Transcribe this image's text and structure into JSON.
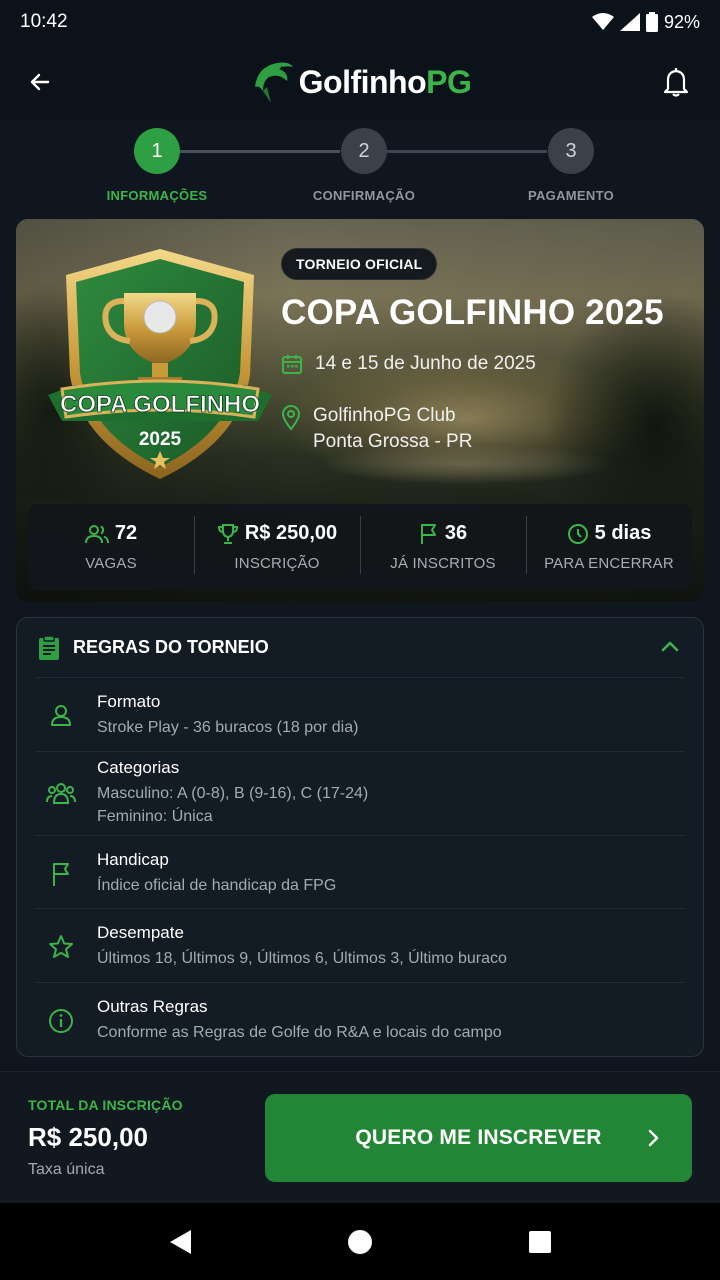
{
  "status": {
    "time": "10:42",
    "battery": "92%"
  },
  "header": {
    "logo_part1": "Golfinho",
    "logo_part2": "PG"
  },
  "steps": [
    {
      "number": "1",
      "label": "INFORMAÇÕES",
      "active": true
    },
    {
      "number": "2",
      "label": "CONFIRMAÇÃO",
      "active": false
    },
    {
      "number": "3",
      "label": "PAGAMENTO",
      "active": false
    }
  ],
  "hero": {
    "badge": "TORNEIO OFICIAL",
    "title": "COPA GOLFINHO 2025",
    "date": "14 e 15 de Junho de 2025",
    "location_line1": "GolfinhoPG Club",
    "location_line2": "Ponta Grossa - PR",
    "shield_ribbon": "COPA GOLFINHO",
    "shield_year": "2025"
  },
  "stats": [
    {
      "value": "72",
      "label": "VAGAS",
      "icon": "users-icon"
    },
    {
      "value": "R$ 250,00",
      "label": "INSCRIÇÃO",
      "icon": "trophy-icon"
    },
    {
      "value": "36",
      "label": "JÁ INSCRITOS",
      "icon": "flag-icon"
    },
    {
      "value": "5 dias",
      "label": "PARA ENCERRAR",
      "icon": "clock-icon"
    }
  ],
  "rules": {
    "title": "REGRAS DO TORNEIO",
    "items": [
      {
        "name": "Formato",
        "desc": "Stroke Play - 36 buracos (18 por dia)",
        "icon": "user-icon"
      },
      {
        "name": "Categorias",
        "desc": "Masculino: A (0-8), B (9-16), C (17-24)",
        "desc2": "Feminino: Única",
        "icon": "group-icon"
      },
      {
        "name": "Handicap",
        "desc": "Índice oficial de handicap da FPG",
        "icon": "flag-icon"
      },
      {
        "name": "Desempate",
        "desc": "Últimos 18, Últimos 9, Últimos 6, Últimos 3, Último buraco",
        "icon": "star-icon"
      },
      {
        "name": "Outras Regras",
        "desc": "Conforme as Regras de Golfe do R&A e locais do campo",
        "icon": "info-icon"
      }
    ]
  },
  "footer": {
    "total_label": "TOTAL DA INSCRIÇÃO",
    "total_value": "R$ 250,00",
    "total_note": "Taxa única",
    "cta_label": "QUERO ME INSCREVER"
  },
  "colors": {
    "accent": "#3bb54a",
    "cta": "#238636",
    "background": "#0f1620"
  }
}
